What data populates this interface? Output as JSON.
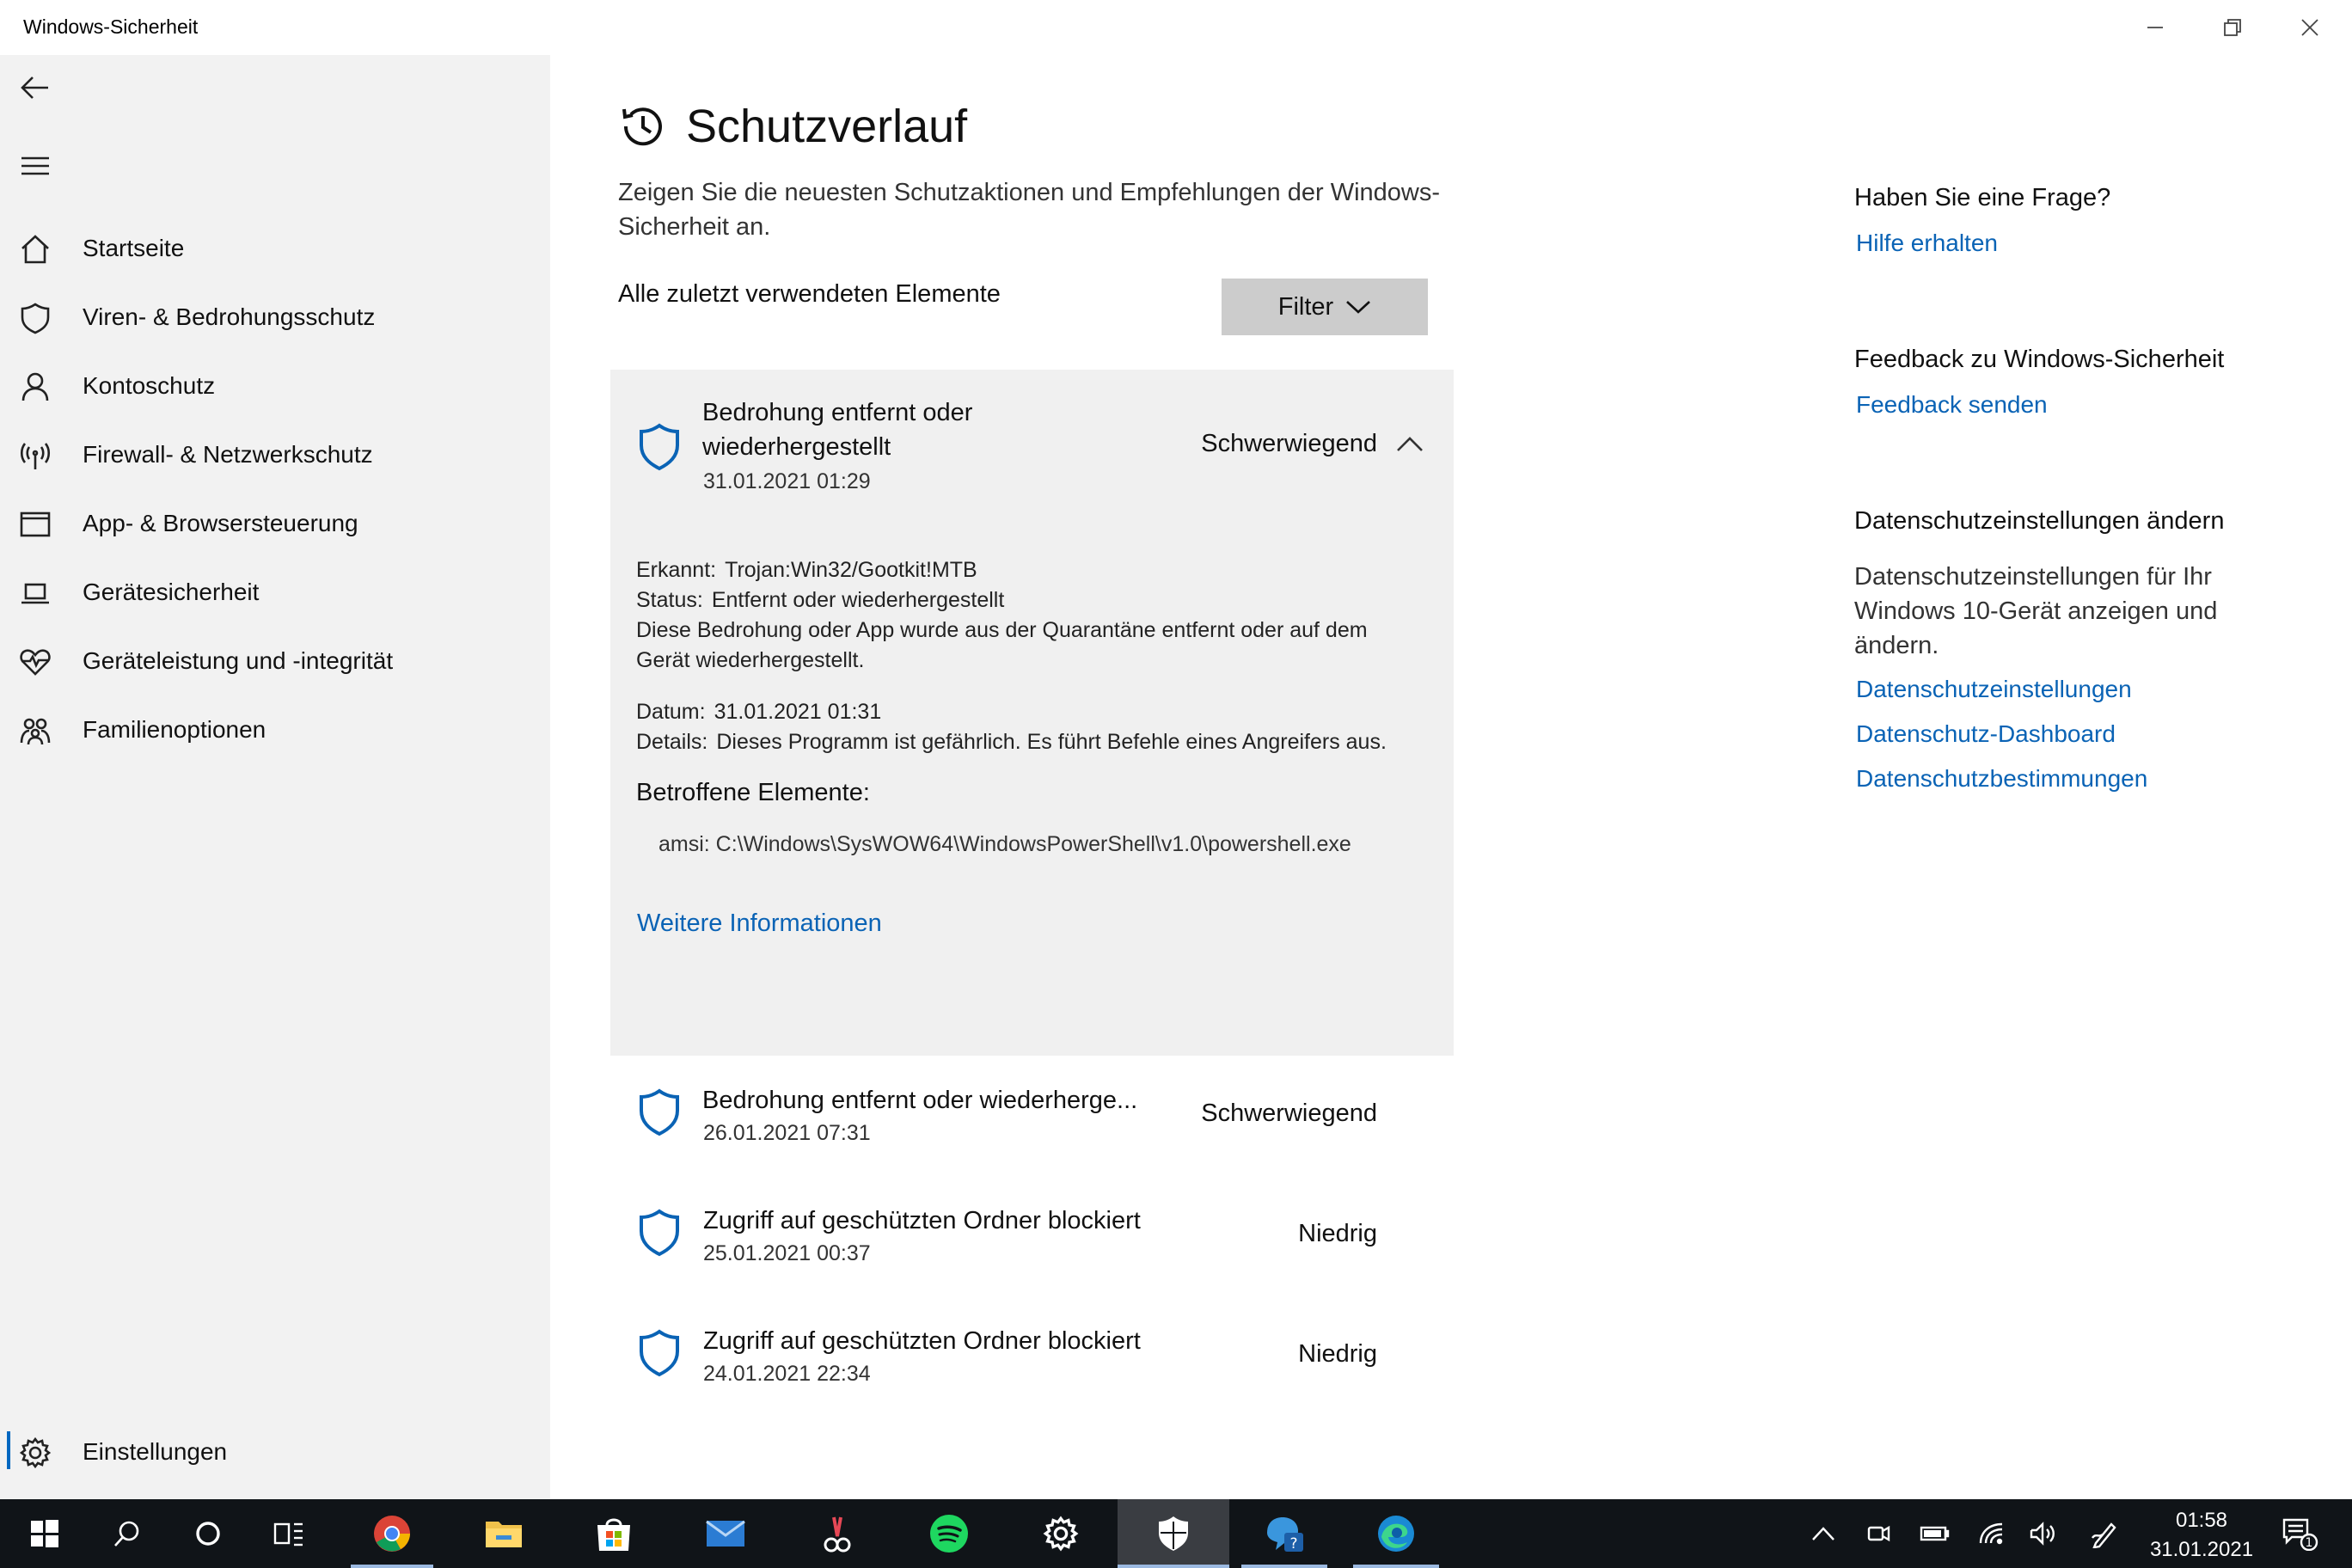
{
  "window": {
    "title": "Windows-Sicherheit"
  },
  "sidebar": {
    "items": [
      {
        "label": "Startseite",
        "icon": "home-icon"
      },
      {
        "label": "Viren- & Bedrohungsschutz",
        "icon": "shield-icon"
      },
      {
        "label": "Kontoschutz",
        "icon": "person-icon"
      },
      {
        "label": "Firewall- & Netzwerkschutz",
        "icon": "antenna-icon"
      },
      {
        "label": "App- & Browsersteuerung",
        "icon": "window-icon"
      },
      {
        "label": "Gerätesicherheit",
        "icon": "laptop-icon"
      },
      {
        "label": "Geräteleistung und -integrität",
        "icon": "heart-pulse-icon"
      },
      {
        "label": "Familienoptionen",
        "icon": "family-icon"
      }
    ],
    "settings_label": "Einstellungen"
  },
  "main": {
    "title": "Schutzverlauf",
    "description": "Zeigen Sie die neuesten Schutzaktionen und Empfehlungen der Windows-Sicherheit an.",
    "section_label": "Alle zuletzt verwendeten Elemente",
    "filter_label": "Filter",
    "expanded": {
      "title_line1": "Bedrohung entfernt oder",
      "title_line2": "wiederhergestellt",
      "date": "31.01.2021 01:29",
      "severity": "Schwerwiegend",
      "detected_key": "Erkannt:",
      "detected_val": "Trojan:Win32/Gootkit!MTB",
      "status_key": "Status:",
      "status_val": "Entfernt oder wiederhergestellt",
      "note_line1": "Diese Bedrohung oder App wurde aus der Quarantäne entfernt oder auf dem",
      "note_line2": "Gerät wiederhergestellt.",
      "date_key": "Datum:",
      "date_val": "31.01.2021 01:31",
      "details_key": "Details:",
      "details_val": "Dieses Programm ist gefährlich. Es führt Befehle eines Angreifers aus.",
      "affected_heading": "Betroffene Elemente:",
      "affected_path": "amsi: C:\\Windows\\SysWOW64\\WindowsPowerShell\\v1.0\\powershell.exe",
      "more_link": "Weitere Informationen"
    },
    "items": [
      {
        "title": "Bedrohung entfernt oder wiederherge...",
        "date": "26.01.2021 07:31",
        "severity": "Schwerwiegend"
      },
      {
        "title": "Zugriff auf geschützten Ordner blockiert",
        "date": "25.01.2021 00:37",
        "severity": "Niedrig"
      },
      {
        "title": "Zugriff auf geschützten Ordner blockiert",
        "date": "24.01.2021 22:34",
        "severity": "Niedrig"
      }
    ]
  },
  "right": {
    "question_heading": "Haben Sie eine Frage?",
    "help_link": "Hilfe erhalten",
    "feedback_heading": "Feedback zu Windows-Sicherheit",
    "feedback_link": "Feedback senden",
    "privacy_heading": "Datenschutzeinstellungen ändern",
    "privacy_text": "Datenschutzeinstellungen für Ihr Windows 10-Gerät anzeigen und ändern.",
    "privacy_links": [
      "Datenschutzeinstellungen",
      "Datenschutz-Dashboard",
      "Datenschutzbestimmungen"
    ]
  },
  "taskbar": {
    "apps": [
      "windows-start-icon",
      "search-icon",
      "cortana-icon",
      "task-view-icon",
      "chrome-icon",
      "file-explorer-icon",
      "store-icon",
      "mail-icon",
      "snipping-icon",
      "spotify-icon",
      "settings-icon",
      "windows-security-icon",
      "get-help-icon",
      "edge-icon"
    ],
    "time": "01:58",
    "date": "31.01.2021",
    "notification_count": "1"
  },
  "colors": {
    "accent": "#0a63b5",
    "sidebar_bg": "#f2f2f2",
    "card_bg": "#f0f0f0",
    "taskbar_bg": "#101418"
  }
}
